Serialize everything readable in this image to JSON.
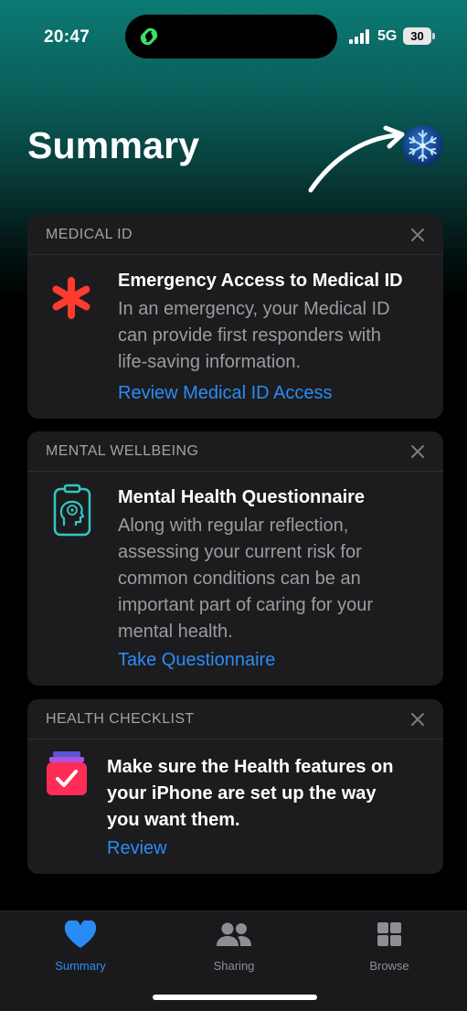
{
  "status_bar": {
    "time": "20:47",
    "network": "5G",
    "battery": "30",
    "island_icon": "link-icon"
  },
  "header": {
    "title": "Summary",
    "avatar_icon": "snowflake-icon",
    "annotation_icon": "curved-arrow-icon"
  },
  "cards": [
    {
      "section": "MEDICAL ID",
      "icon": "asterisk-icon",
      "title": "Emergency Access to Medical ID",
      "body_lines": [
        "In an emergency, your Medical ID",
        "can provide first responders with",
        "life-saving information."
      ],
      "link": "Review Medical ID Access"
    },
    {
      "section": "MENTAL WELLBEING",
      "icon": "head-clipboard-icon",
      "title": "Mental Health Questionnaire",
      "body_lines": [
        "Along with regular reflection,",
        "assessing your current risk for",
        "common conditions can be an",
        "important part of caring for your",
        "mental health."
      ],
      "link": "Take Questionnaire"
    },
    {
      "section": "HEALTH CHECKLIST",
      "icon": "checklist-icon",
      "title_lines": [
        "Make sure the Health features on",
        "your iPhone are set up the way",
        "you want them."
      ],
      "link": "Review"
    }
  ],
  "tab_bar": {
    "tabs": [
      {
        "label": "Summary",
        "icon": "heart-icon",
        "active": true
      },
      {
        "label": "Sharing",
        "icon": "people-icon",
        "active": false
      },
      {
        "label": "Browse",
        "icon": "grid-icon",
        "active": false
      }
    ]
  },
  "colors": {
    "accent": "#2b8bf5",
    "header_gradient": "#0c7a74",
    "card_bg": "#1c1c1e",
    "medical_red": "#ff3b30",
    "mental_teal": "#35c7c1",
    "checklist_pink": "#ff2d55"
  }
}
